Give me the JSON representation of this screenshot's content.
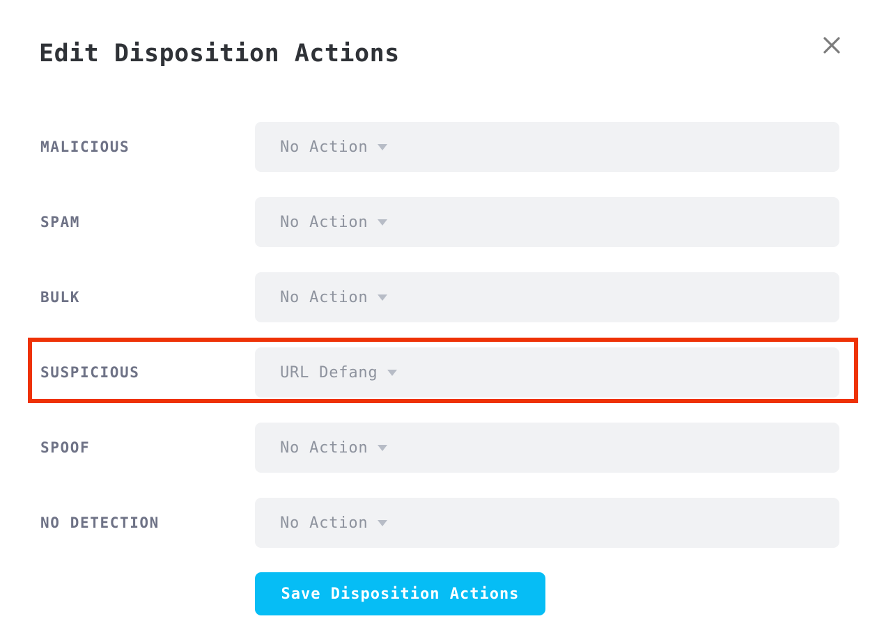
{
  "dialog": {
    "title": "Edit Disposition Actions",
    "close_icon": "close-icon"
  },
  "rows": [
    {
      "label": "MALICIOUS",
      "value": "No Action",
      "caret": "chevron-down-icon"
    },
    {
      "label": "SPAM",
      "value": "No Action",
      "caret": "chevron-down-icon"
    },
    {
      "label": "BULK",
      "value": "No Action",
      "caret": "chevron-down-icon"
    },
    {
      "label": "SUSPICIOUS",
      "value": "URL Defang",
      "caret": "chevron-down-icon"
    },
    {
      "label": "SPOOF",
      "value": "No Action",
      "caret": "chevron-down-icon"
    },
    {
      "label": "NO DETECTION",
      "value": "No Action",
      "caret": "chevron-down-icon"
    }
  ],
  "footer": {
    "save_label": "Save Disposition Actions"
  },
  "annotation": {
    "highlighted_row_label": "SUSPICIOUS",
    "color": "#ee3206"
  },
  "colors": {
    "accent": "#06bdf5",
    "dropdown_bg": "#f1f2f4",
    "label_text": "#6e7286",
    "value_text": "#8e939e",
    "title_text": "#2f3237",
    "highlight": "#ee3206",
    "page_bg": "#ffffff"
  }
}
